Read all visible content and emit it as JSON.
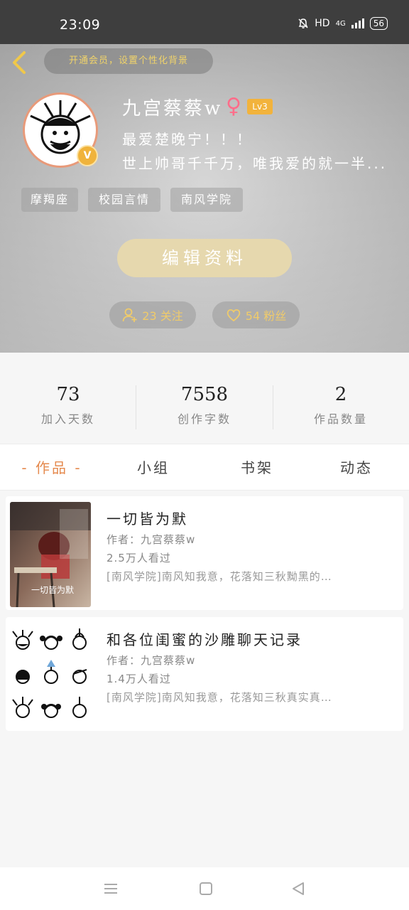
{
  "status_bar": {
    "time": "23:09",
    "network": "HD",
    "signal_label": "4G",
    "battery": "56"
  },
  "header": {
    "member_prompt": "开通会员，设置个性化背景",
    "username": "九宫蔡蔡w",
    "gender": "♀",
    "level": "Lv3",
    "vip_badge": "V",
    "bio_line_1": "最爱楚晚宁！！！",
    "bio_line_2": "世上帅哥千千万，唯我爱的就一半...",
    "tags": [
      "摩羯座",
      "校园言情",
      "南风学院"
    ],
    "edit_button": "编辑资料",
    "following": "23 关注",
    "fans": "54 粉丝"
  },
  "stats": [
    {
      "value": "73",
      "label": "加入天数"
    },
    {
      "value": "7558",
      "label": "创作字数"
    },
    {
      "value": "2",
      "label": "作品数量"
    }
  ],
  "tabs": [
    {
      "label": "- 作品 -",
      "active": true
    },
    {
      "label": "小组",
      "active": false
    },
    {
      "label": "书架",
      "active": false
    },
    {
      "label": "动态",
      "active": false
    }
  ],
  "works": [
    {
      "title": "一切皆为默",
      "author": "作者：九宫蔡蔡w",
      "views": "2.5万人看过",
      "desc": "[南风学院]南风知我意，花落知三秋黝黑的…",
      "cover_text": "一切皆为默"
    },
    {
      "title": "和各位闺蜜的沙雕聊天记录",
      "author": "作者：九宫蔡蔡w",
      "views": "1.4万人看过",
      "desc": "[南风学院]南风知我意，花落知三秋真实真…"
    }
  ],
  "colors": {
    "accent": "#e58a4e",
    "gold": "#f0cb6a",
    "edit_button_bg": "#e6d8ae",
    "level_badge": "#f2b33c",
    "gender": "#ff6d8a"
  }
}
